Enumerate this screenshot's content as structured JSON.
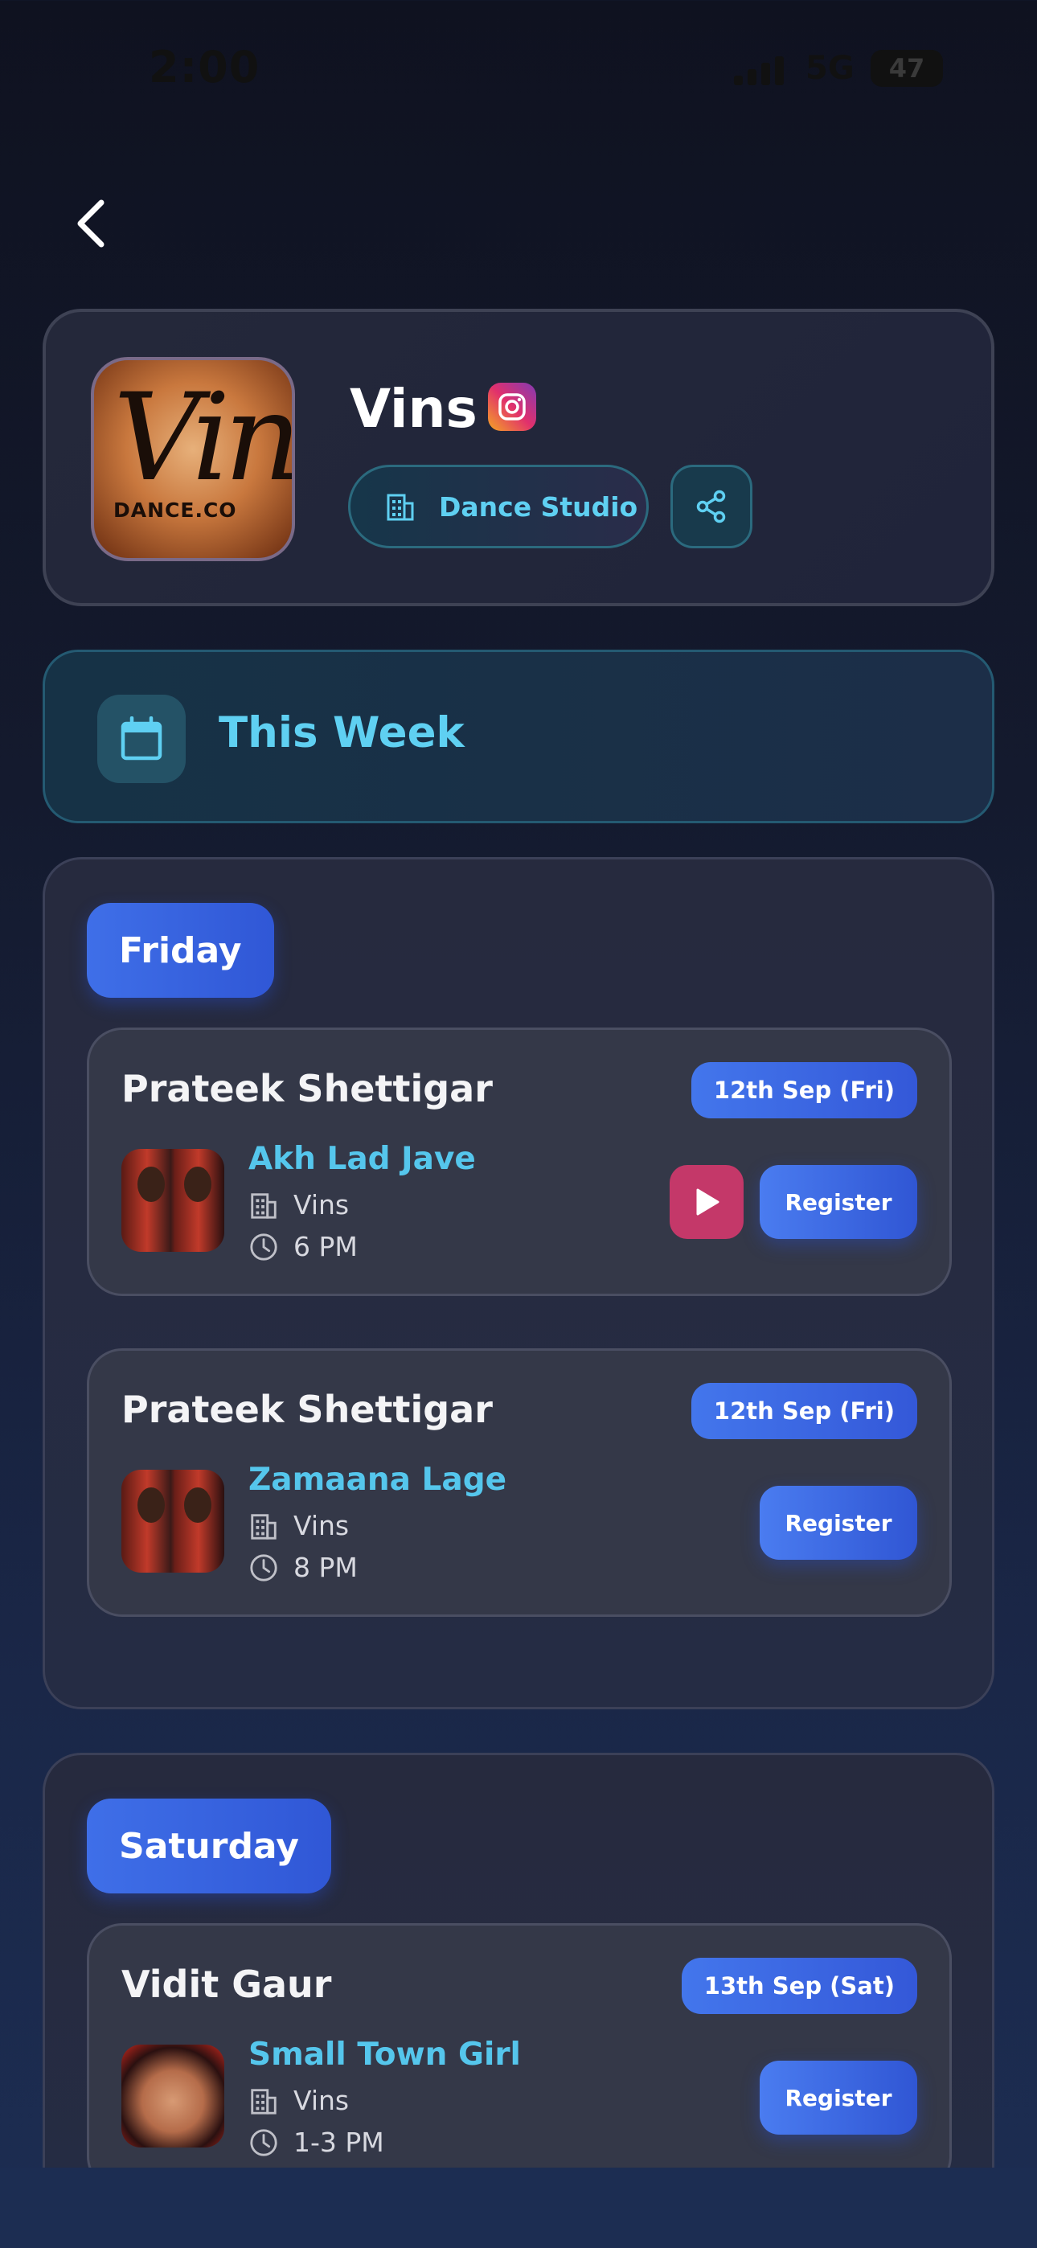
{
  "status_bar": {
    "time": "2:00",
    "network": "5G",
    "battery": "47"
  },
  "profile": {
    "name": "Vins",
    "logo_text": "Vins",
    "logo_subtext": "DANCE.CO",
    "category": "Dance Studio"
  },
  "week": {
    "title": "This Week"
  },
  "days": [
    {
      "label": "Friday",
      "classes": [
        {
          "teacher": "Prateek Shettigar",
          "date": "12th Sep (Fri)",
          "song": "Akh Lad Jave",
          "venue": "Vins",
          "time": "6 PM",
          "register_label": "Register"
        },
        {
          "teacher": "Prateek Shettigar",
          "date": "12th Sep (Fri)",
          "song": "Zamaana Lage",
          "venue": "Vins",
          "time": "8 PM",
          "register_label": "Register"
        }
      ]
    },
    {
      "label": "Saturday",
      "classes": [
        {
          "teacher": "Vidit Gaur",
          "date": "13th Sep (Sat)",
          "song": "Small Town Girl",
          "venue": "Vins",
          "time": "1-3 PM",
          "register_label": "Register"
        }
      ]
    }
  ],
  "colors": {
    "accent_blue": "#3f6fe8",
    "accent_cyan": "#55c6ec",
    "play_pink": "#c43869"
  }
}
